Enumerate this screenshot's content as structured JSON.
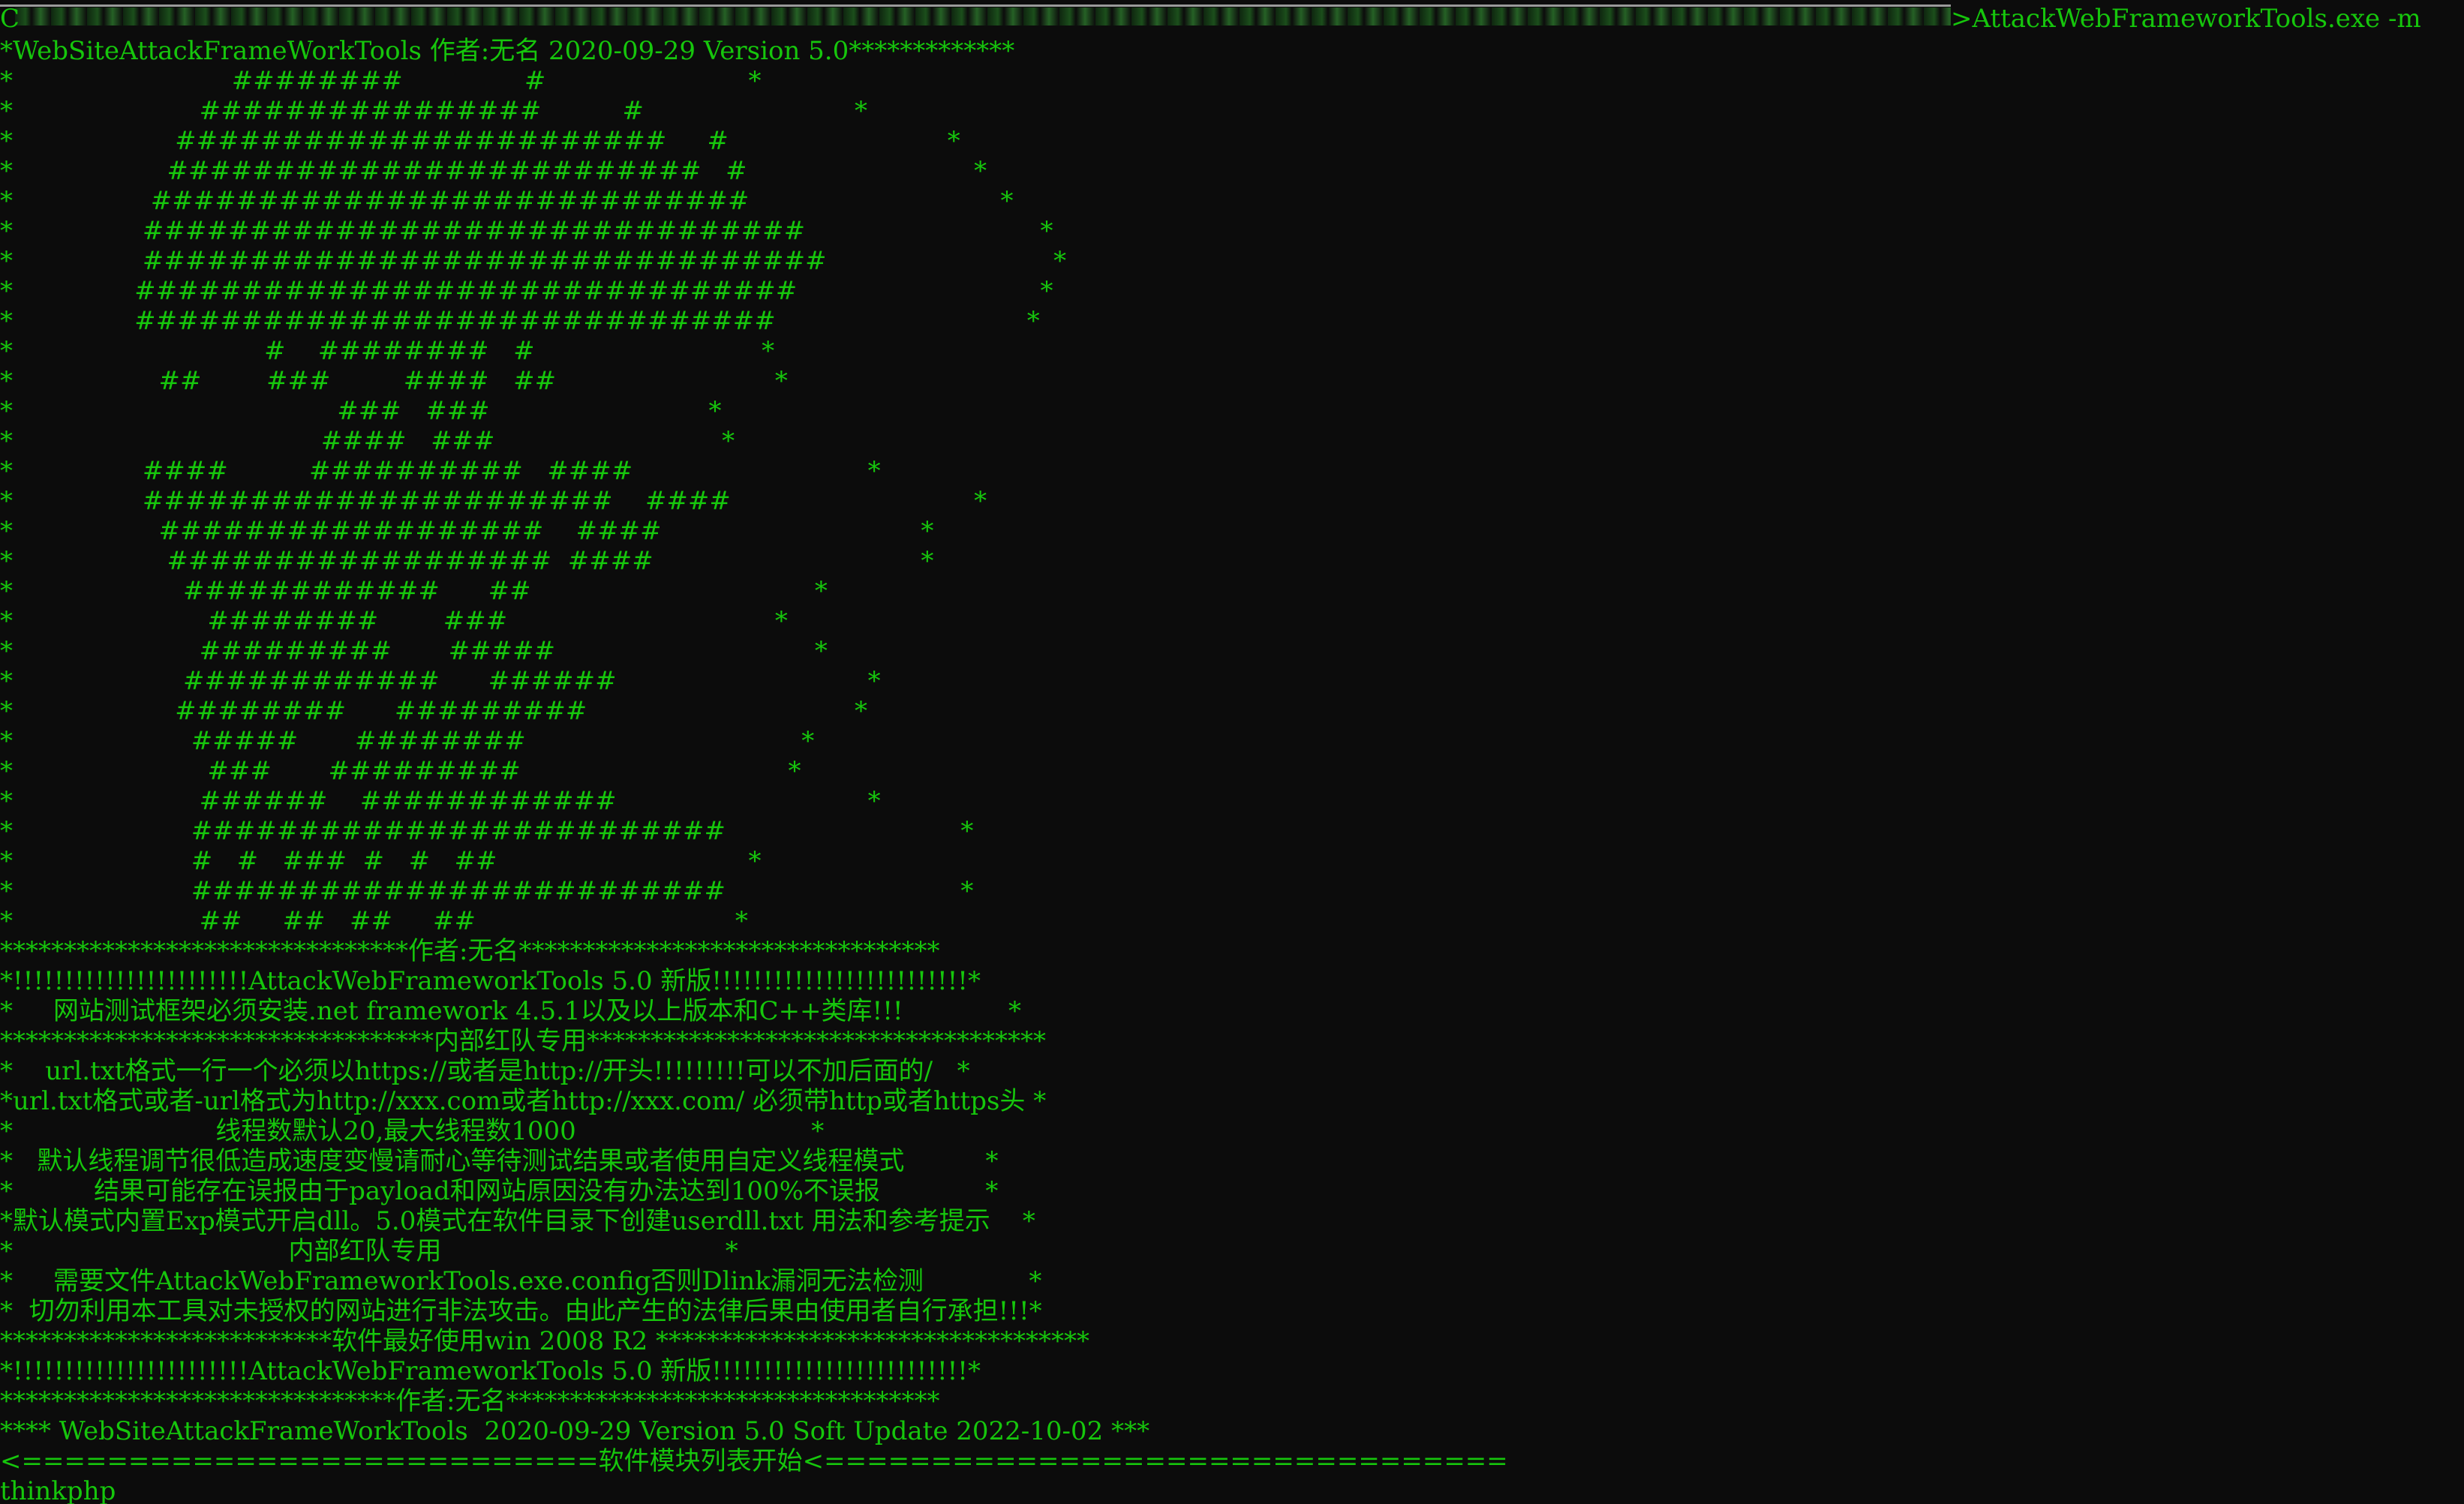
{
  "window": {
    "type": "console",
    "accent_color": "#16c60c",
    "background_color": "#0c0c0c"
  },
  "command": {
    "prefix": "C",
    "path_redacted": true,
    "text": ">AttackWebFrameworkTools.exe -m"
  },
  "lines": [
    "*WebSiteAttackFrameWorkTools 作者:无名 2020-09-29 Version 5.0*************",
    "*                           ########               #                         *",
    "*                       ################          #                          *",
    "*                    #######################     #                           *",
    "*                   #########################   #                            *",
    "*                 ############################                               *",
    "*                ###############################                             *",
    "*                ################################                            *",
    "*               ###############################                              *",
    "*               ##############################                               *",
    "*                               #    ########   #                            *",
    "*                  ##        ###         ####   ##                           *",
    "*                                        ###   ###                           *",
    "*                                      ####   ###                            *",
    "*                ####          ##########   ####                             *",
    "*                ######################    ####                              *",
    "*                  ##################    ####                                *",
    "*                   ##################  ####                                 *",
    "*                     ############      ##                                   *",
    "*                        ########        ###                                 *",
    "*                       #########       #####                                *",
    "*                     ############      ######                               *",
    "*                    ########      #########                                 *",
    "*                      #####       ########                                  *",
    "*                        ###       #########                                 *",
    "*                       ######    ############                               *",
    "*                      #########################                             *",
    "*                      #   #   ###  #   #   ##                               *",
    "*                      #########################                             *",
    "*                       ##     ##   ##     ##                                *",
    "********************************作者:无名*********************************",
    "*!!!!!!!!!!!!!!!!!!!!!!!AttackWebFrameworkTools 5.0 新版!!!!!!!!!!!!!!!!!!!!!!!!!*",
    "*     网站测试框架必须安装.net framework 4.5.1以及以上版本和C++类库!!!             *",
    "**********************************内部红队专用************************************",
    "*    url.txt格式一行一个必须以https://或者是http://开头!!!!!!!!!可以不加后面的/   *",
    "*url.txt格式或者-url格式为http://xxx.com或者http://xxx.com/ 必须带http或者https头 *",
    "*                         线程数默认20,最大线程数1000                             *",
    "*   默认线程调节很低造成速度变慢请耐心等待测试结果或者使用自定义线程模式          *",
    "*          结果可能存在误报由于payload和网站原因没有办法达到100%不误报             *",
    "*默认模式内置Exp模式开启dll。5.0模式在软件目录下创建userdll.txt 用法和参考提示    *",
    "*                                  内部红队专用                                   *",
    "*     需要文件AttackWebFrameworkTools.exe.config否则Dlink漏洞无法检测             *",
    "*  切勿利用本工具对未授权的网站进行非法攻击。由此产生的法律后果由使用者自行承担!!!*",
    "**************************软件最好使用win 2008 R2 **********************************",
    "*!!!!!!!!!!!!!!!!!!!!!!!AttackWebFrameworkTools 5.0 新版!!!!!!!!!!!!!!!!!!!!!!!!!*",
    "*******************************作者:无名**********************************",
    "**** WebSiteAttackFrameWorkTools  2020-09-29 Version 5.0 Soft Update 2022-10-02 ***",
    "<===========================软件模块列表开始<================================",
    "thinkphp"
  ]
}
